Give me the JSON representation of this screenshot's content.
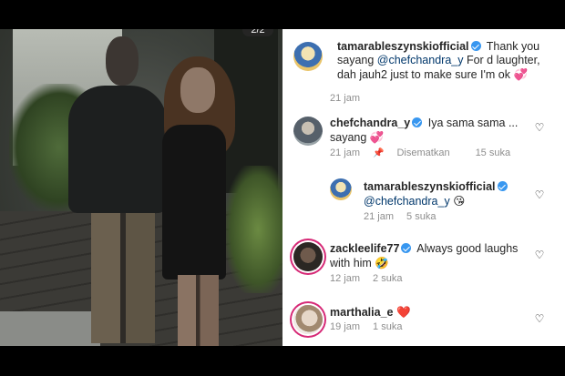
{
  "media": {
    "counter": "2/2"
  },
  "comments": [
    {
      "username": "tamarableszynskiofficial",
      "verified": true,
      "text_prefix": "Thank you sayang ",
      "mention": "@chefchandra_y",
      "text_suffix": " For d laughter, dah jauh2 just to make sure I'm ok",
      "emoji": "💞",
      "time": "21 jam",
      "avatar": "tamarableszynskiofficial-avatar",
      "has_like": false
    },
    {
      "username": "chefchandra_y",
      "verified": true,
      "text_prefix": "Iya sama sama ... sayang",
      "emoji": "💞",
      "time": "21 jam",
      "pinned": "Disematkan",
      "likes": "15 suka",
      "avatar": "chefchandra_y-avatar",
      "has_like": true
    },
    {
      "username": "tamarableszynskiofficial",
      "verified": true,
      "mention": "@chefchandra_y",
      "emoji": "😘",
      "time": "21 jam",
      "likes": "5 suka",
      "avatar": "tamarableszynskiofficial-avatar",
      "has_like": true,
      "reply": true
    },
    {
      "username": "zackleelife77",
      "verified": true,
      "text_prefix": "Always good laughs with him",
      "emoji": "🤣",
      "time": "12 jam",
      "likes": "2 suka",
      "avatar": "zackleelife77-avatar",
      "has_like": true
    },
    {
      "username": "marthalia_e",
      "verified": false,
      "emoji": "❤️",
      "time": "19 jam",
      "likes": "1 suka",
      "avatar": "marthalia_e-avatar",
      "has_like": true
    }
  ],
  "icons": {
    "like": "heart-outline-icon",
    "pinned": "pin-icon",
    "verified": "verified-badge-icon"
  },
  "colors": {
    "verified": "#3897f0",
    "mention": "#00376b",
    "meta": "#8e8e8e",
    "story_ring": "#d62976"
  }
}
